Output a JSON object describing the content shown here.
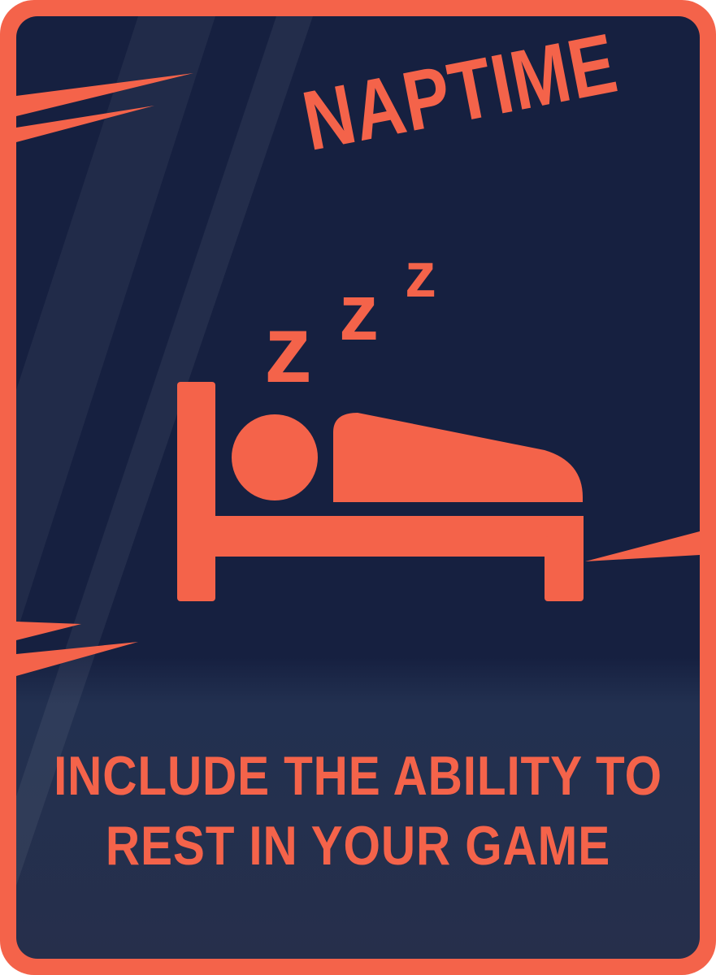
{
  "card": {
    "title": "NAPTIME",
    "caption_line1": "INCLUDE THE ABILITY TO",
    "caption_line2": "REST IN YOUR GAME",
    "icon": "sleeping-in-bed-icon",
    "z_glyph": "z",
    "colors": {
      "accent": "#f4634a",
      "background": "#162040",
      "background_bottom": "#262f4b"
    }
  }
}
